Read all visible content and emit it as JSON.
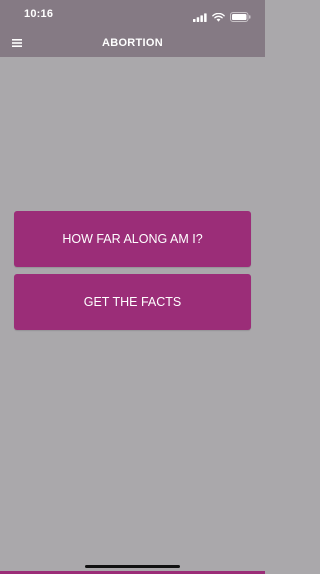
{
  "status_bar": {
    "time": "10:16",
    "icons": [
      "cellular-signal-icon",
      "wifi-icon",
      "battery-icon"
    ]
  },
  "nav_bar": {
    "title": "ABORTION",
    "menu_icon": "hamburger-menu-icon"
  },
  "main": {
    "buttons": [
      {
        "label": "HOW FAR ALONG AM I?"
      },
      {
        "label": "GET THE FACTS"
      }
    ]
  },
  "colors": {
    "header_background": "#857a84",
    "page_background": "#aaa8ab",
    "button_background": "#9b2d78",
    "text_light": "#ffffff"
  }
}
